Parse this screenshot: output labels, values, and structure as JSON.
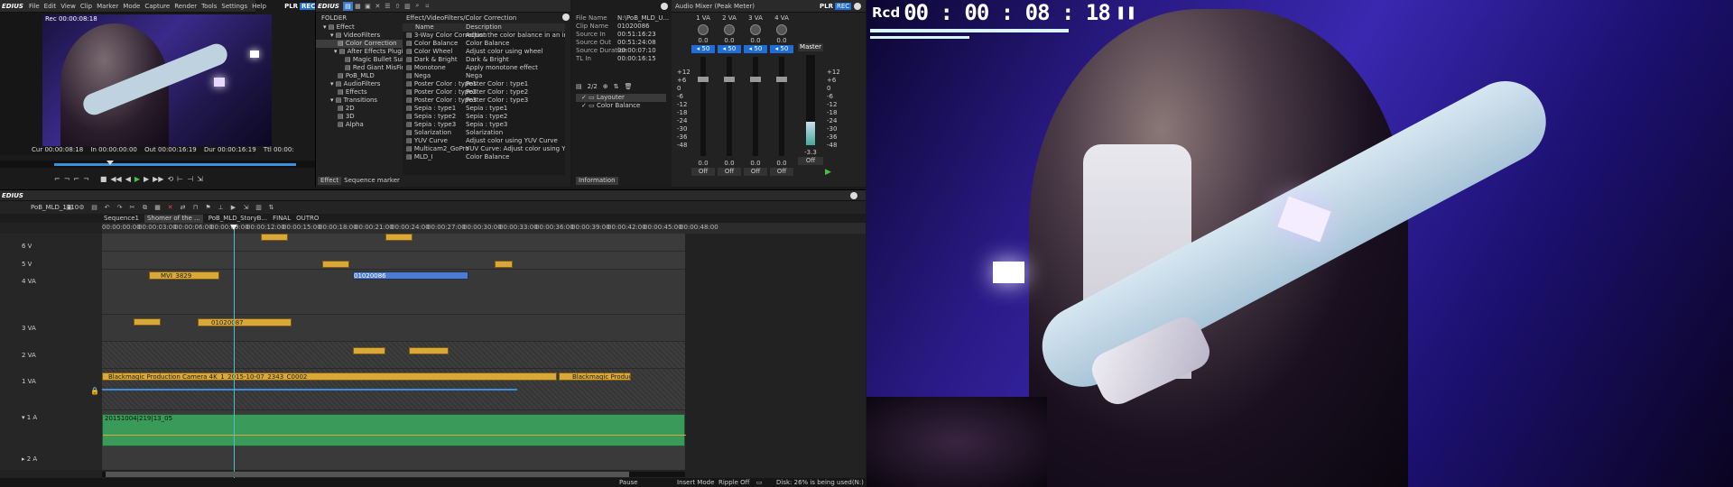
{
  "app": {
    "name": "EDIUS",
    "menu": [
      "File",
      "Edit",
      "View",
      "Clip",
      "Marker",
      "Mode",
      "Capture",
      "Render",
      "Tools",
      "Settings",
      "Help"
    ],
    "plr": "PLR",
    "rec": "REC"
  },
  "player": {
    "timecode": "00:00:08:18",
    "cur_label": "Cur",
    "cur_val": "00:00:08:18",
    "in_label": "In",
    "in_val": "00:00:00:00",
    "out_label": "Out",
    "out_val": "00:00:16:19",
    "dur_label": "Dur",
    "dur_val": "00:00:16:19",
    "ttl_label": "Ttl",
    "ttl_val": "00:00:53:19"
  },
  "palette": {
    "title": "EDIUS",
    "folder_label": "FOLDER",
    "path": "Effect/VideoFilters/Color Correction",
    "col_name": "Name",
    "col_desc": "Description",
    "tree": [
      "Effect",
      "VideoFilters",
      "Color Correction",
      "After Effects Plugin",
      "Magic Bullet Suite",
      "Red Giant MisFire",
      "PoB_MLD",
      "AudioFilters",
      "Effects",
      "Transitions",
      "2D",
      "3D",
      "Alpha"
    ],
    "effects": [
      [
        "3-Way Color Correction",
        "Adjust the color balance in an image"
      ],
      [
        "Color Balance",
        "Color Balance"
      ],
      [
        "Color Wheel",
        "Adjust color using wheel"
      ],
      [
        "Dark & Bright",
        "Dark & Bright"
      ],
      [
        "Monotone",
        "Apply monotone effect"
      ],
      [
        "Nega",
        "Nega"
      ],
      [
        "Poster Color : type1",
        "Poster Color : type1"
      ],
      [
        "Poster Color : type2",
        "Poster Color : type2"
      ],
      [
        "Poster Color : type3",
        "Poster Color : type3"
      ],
      [
        "Sepia : type1",
        "Sepia : type1"
      ],
      [
        "Sepia : type2",
        "Sepia : type2"
      ],
      [
        "Sepia : type3",
        "Sepia : type3"
      ],
      [
        "Solarization",
        "Solarization"
      ],
      [
        "YUV Curve",
        "Adjust color using YUV Curve"
      ],
      [
        "Multicam2_GoPro",
        "YUV Curve: Adjust color using YUV Curve"
      ],
      [
        "MLD_I",
        "Color Balance"
      ]
    ],
    "tab_effect": "Effect",
    "tab_marker": "Sequence marker"
  },
  "info": {
    "fields": [
      [
        "File Name",
        "N:\\PoB_MLD_U..."
      ],
      [
        "Clip Name",
        "01020086"
      ],
      [
        "Source In",
        "00:51:16:23"
      ],
      [
        "Source Out",
        "00:51:24:08"
      ],
      [
        "Source Duration",
        "00:00:07:10"
      ],
      [
        "TL In",
        "00:00:16:15"
      ]
    ],
    "layer_count": "2/2",
    "layers": [
      "Layouter",
      "Color Balance"
    ],
    "tab": "Information"
  },
  "mixer": {
    "title": "Audio Mixer (Peak Meter)",
    "channels": [
      "1 VA",
      "2 VA",
      "3 VA",
      "4 VA"
    ],
    "master": "Master",
    "pan": "0.0",
    "sel": "50",
    "off": "Off",
    "scale": [
      "+12",
      "+6",
      "0",
      "-6",
      "-12",
      "-18",
      "-24",
      "-30",
      "-36",
      "-48",
      "-inf"
    ],
    "readout": "-3.3",
    "plr": "PLR",
    "rec": "REC"
  },
  "timeline": {
    "title": "EDIUS",
    "project": "PoB_MLD_1710",
    "tabs": [
      "Sequence1",
      "Shomer of the ...",
      "PoB_MLD_StoryB...",
      "FINAL",
      "OUTRO"
    ],
    "ruler": [
      "00:00:00:00",
      "00:00:03:00",
      "00:00:06:00",
      "00:00:09:00",
      "00:00:12:00",
      "00:00:15:00",
      "00:00:18:00",
      "00:00:21:00",
      "00:00:24:00",
      "00:00:27:00",
      "00:00:30:00",
      "00:00:33:00",
      "00:00:36:00",
      "00:00:39:00",
      "00:00:42:00",
      "00:00:45:00",
      "00:00:48:00"
    ],
    "tracks": [
      "6 V",
      "5 V",
      "4 VA",
      "3 VA",
      "2 VA",
      "1 VA",
      "1 A",
      "2 A"
    ],
    "clips": {
      "mvi": "MVI_3829",
      "c086": "01020086",
      "c087": "01020087",
      "bm1": "Blackmagic Production Camera 4K_1_2015-10-07_2343_C0002",
      "bm2": "Blackmagic Product...",
      "audio": "20151004|219|13_05"
    }
  },
  "status": {
    "pause": "Pause",
    "insert": "Insert Mode",
    "ripple": "Ripple Off",
    "disk": "Disk: 26% is being used(N:)"
  },
  "recorder": {
    "label": "Rcd",
    "timecode": "00 : 00 : 08 : 18",
    "pause_icon": "pause-icon"
  }
}
